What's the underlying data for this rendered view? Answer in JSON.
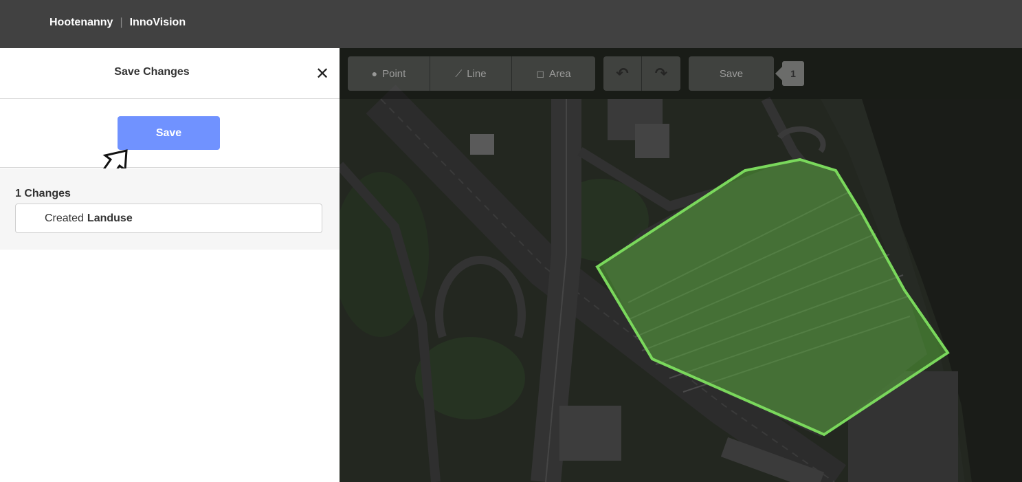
{
  "topbar": {
    "brand_left": "Hootenanny",
    "separator": "|",
    "brand_right": "InnoVision"
  },
  "panel": {
    "title": "Save Changes",
    "close_icon": "close-icon",
    "save_button_label": "Save",
    "changes_count_label": "1 Changes",
    "change_action": "Created",
    "change_feature": "Landuse"
  },
  "map_toolbar": {
    "point_label": "Point",
    "line_label": "Line",
    "area_label": "Area",
    "undo_icon": "undo-icon",
    "redo_icon": "redo-icon",
    "save_label": "Save",
    "edit_count": "1"
  },
  "colors": {
    "topbar": "#414141",
    "save_button": "#7092ff",
    "selected_area_stroke": "#7ad85c",
    "selected_area_fill": "#5fbf3f"
  }
}
